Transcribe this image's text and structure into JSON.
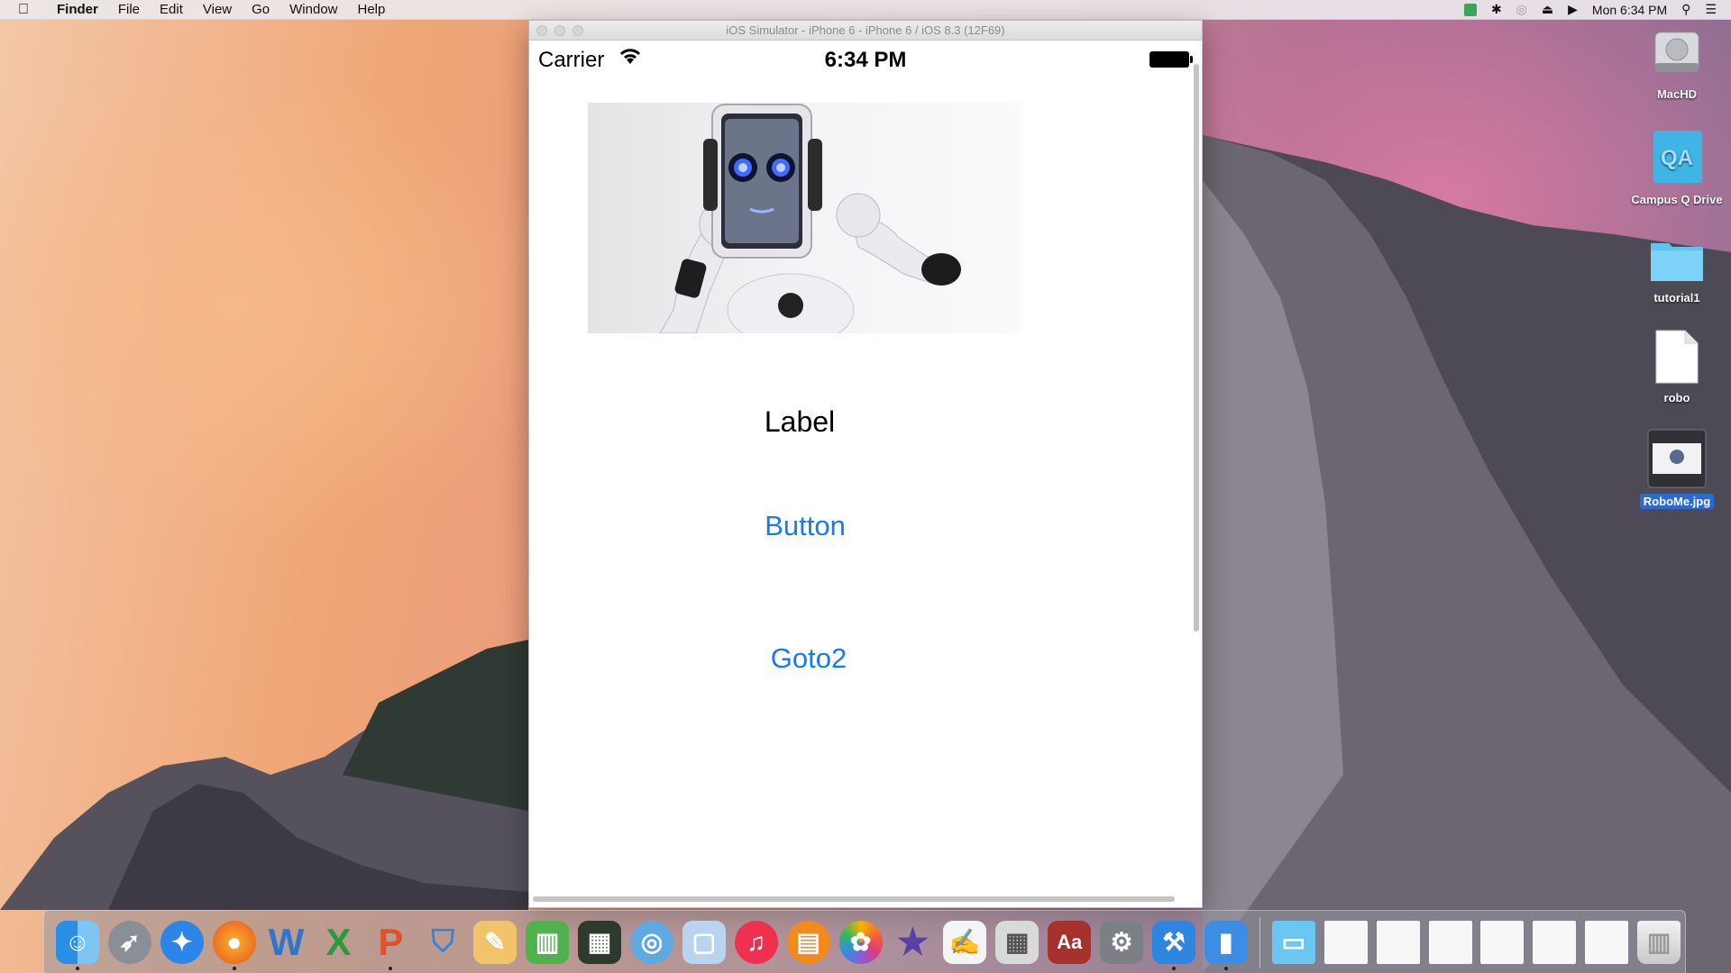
{
  "menubar": {
    "app_name": "Finder",
    "items": [
      "File",
      "Edit",
      "View",
      "Go",
      "Window",
      "Help"
    ],
    "clock": "Mon 6:34 PM"
  },
  "simulator": {
    "window_title": "iOS Simulator - iPhone 6 - iPhone 6 / iOS 8.3 (12F69)",
    "status_bar": {
      "carrier": "Carrier",
      "time": "6:34 PM"
    },
    "screen": {
      "label_text": "Label",
      "button_text": "Button",
      "goto_text": "Goto2"
    }
  },
  "desktop_icons": [
    {
      "name": "MacHD",
      "icon": "hard-drive-icon"
    },
    {
      "name": "Campus Q Drive",
      "icon": "network-drive-icon"
    },
    {
      "name": "tutorial1",
      "icon": "folder-icon"
    },
    {
      "name": "robo",
      "icon": "document-icon"
    },
    {
      "name": "RoboMe.jpg",
      "icon": "image-file-icon",
      "selected": true
    }
  ],
  "dock": {
    "apps": [
      {
        "icon": "finder-icon",
        "running": true
      },
      {
        "icon": "launchpad-icon",
        "running": false
      },
      {
        "icon": "safari-icon",
        "running": false
      },
      {
        "icon": "firefox-icon",
        "running": true
      },
      {
        "icon": "word-icon",
        "running": false
      },
      {
        "icon": "excel-icon",
        "running": false
      },
      {
        "icon": "powerpoint-icon",
        "running": true
      },
      {
        "icon": "keynote-icon",
        "running": false
      },
      {
        "icon": "pages-icon",
        "running": false
      },
      {
        "icon": "numbers-icon",
        "running": false
      },
      {
        "icon": "imovie-icon",
        "running": false
      },
      {
        "icon": "network-icon",
        "running": false
      },
      {
        "icon": "box-icon",
        "running": false
      },
      {
        "icon": "itunes-icon",
        "running": false
      },
      {
        "icon": "ibooks-icon",
        "running": false
      },
      {
        "icon": "photos-icon",
        "running": false
      },
      {
        "icon": "imovie-star-icon",
        "running": false
      },
      {
        "icon": "textedit-icon",
        "running": false
      },
      {
        "icon": "calculator-icon",
        "running": false
      },
      {
        "icon": "dictionary-icon",
        "running": false
      },
      {
        "icon": "system-preferences-icon",
        "running": false
      },
      {
        "icon": "xcode-icon",
        "running": true
      },
      {
        "icon": "ios-simulator-icon",
        "running": true
      }
    ],
    "right_items": [
      {
        "icon": "downloads-folder-icon"
      },
      {
        "icon": "window-thumbnail-icon"
      },
      {
        "icon": "window-thumbnail-icon"
      },
      {
        "icon": "window-thumbnail-icon"
      },
      {
        "icon": "window-thumbnail-icon"
      },
      {
        "icon": "window-thumbnail-icon"
      },
      {
        "icon": "window-thumbnail-icon"
      },
      {
        "icon": "trash-icon"
      }
    ]
  },
  "colors": {
    "ios_tint": "#1a7ae8",
    "selection": "#2a6bd3"
  }
}
